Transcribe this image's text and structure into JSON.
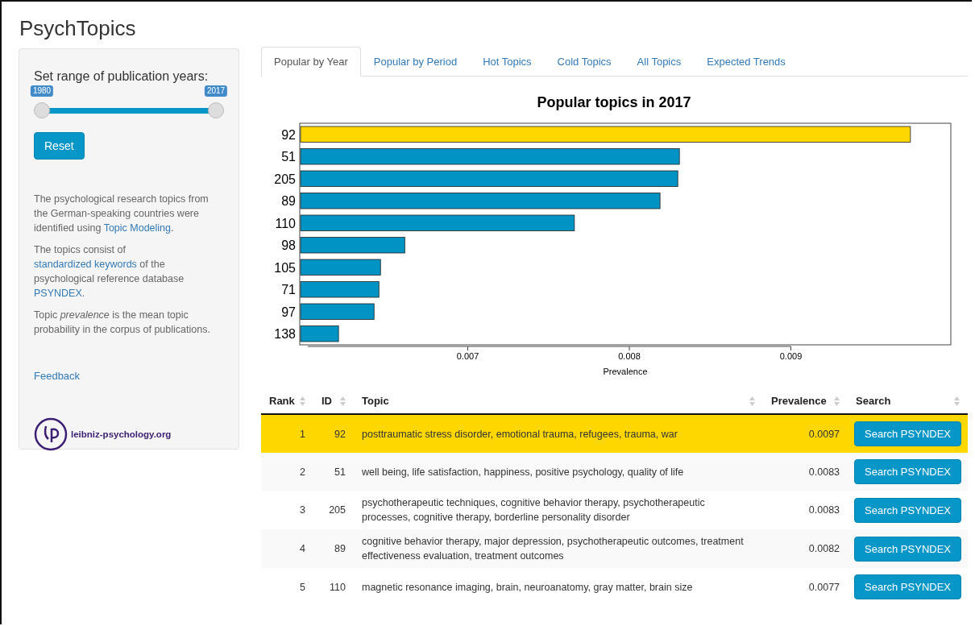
{
  "app_title": "PsychTopics",
  "sidebar": {
    "slider_label": "Set range of publication years:",
    "slider_handles": [
      {
        "label": "1980"
      },
      {
        "label": "2017"
      }
    ],
    "reset_button": "Reset",
    "paragraphs": [
      [
        {
          "kind": "plain",
          "text": "The psychological research topics from the German-speaking countries were identified using "
        },
        {
          "kind": "link",
          "text": "Topic Modeling"
        },
        {
          "kind": "plain",
          "text": "."
        }
      ],
      [
        {
          "kind": "plain",
          "text": "The topics consist of "
        },
        {
          "kind": "link",
          "text": "standardized keywords"
        },
        {
          "kind": "plain",
          "text": " of the psychological reference database "
        },
        {
          "kind": "link",
          "text": "PSYNDEX"
        },
        {
          "kind": "plain",
          "text": "."
        }
      ],
      [
        {
          "kind": "plain",
          "text": "Topic "
        },
        {
          "kind": "italic",
          "text": "prevalence"
        },
        {
          "kind": "plain",
          "text": " is the mean topic probability in the corpus of publications."
        }
      ]
    ],
    "feedback_link": "Feedback",
    "logo_text": "leibniz-psychology.org"
  },
  "tabs": [
    {
      "label": "Popular by Year",
      "selected": true
    },
    {
      "label": "Popular by Period",
      "selected": false
    },
    {
      "label": "Hot Topics",
      "selected": false
    },
    {
      "label": "Cold Topics",
      "selected": false
    },
    {
      "label": "All Topics",
      "selected": false
    },
    {
      "label": "Expected Trends",
      "selected": false
    }
  ],
  "chart_data": {
    "type": "bar",
    "orientation": "horizontal",
    "title": "Popular topics in 2017",
    "xlabel": "Prevalence",
    "categories": [
      "92",
      "51",
      "205",
      "89",
      "110",
      "98",
      "105",
      "71",
      "97",
      "138"
    ],
    "series": [
      {
        "color": "#ffd700",
        "values": [
          0.00974,
          null,
          null,
          null,
          null,
          null,
          null,
          null,
          null,
          null
        ]
      },
      {
        "color": "#0093c4",
        "values": [
          null,
          0.00831,
          0.0083,
          0.00819,
          0.00766,
          0.00661,
          0.00646,
          0.00645,
          0.00642,
          0.0062
        ]
      }
    ],
    "xlim": [
      0.00596,
      0.00999
    ],
    "xticks": [
      0.007,
      0.008,
      0.009
    ]
  },
  "table": {
    "columns": [
      "Rank",
      "ID",
      "Topic",
      "Prevalence",
      "Search"
    ],
    "rows": [
      {
        "rank": "1",
        "id": "92",
        "topic": "posttraumatic stress disorder, emotional trauma, refugees, trauma, war",
        "prevalence": "0.0097",
        "button": "Search PSYNDEX",
        "selected": true
      },
      {
        "rank": "2",
        "id": "51",
        "topic": "well being, life satisfaction, happiness, positive psychology, quality of life",
        "prevalence": "0.0083",
        "button": "Search PSYNDEX",
        "selected": false
      },
      {
        "rank": "3",
        "id": "205",
        "topic": "psychotherapeutic techniques, cognitive behavior therapy, psychotherapeutic processes, cognitive therapy, borderline personality disorder",
        "prevalence": "0.0083",
        "button": "Search PSYNDEX",
        "selected": false
      },
      {
        "rank": "4",
        "id": "89",
        "topic": "cognitive behavior therapy, major depression, psychotherapeutic outcomes, treatment effectiveness evaluation, treatment outcomes",
        "prevalence": "0.0082",
        "button": "Search PSYNDEX",
        "selected": false
      },
      {
        "rank": "5",
        "id": "110",
        "topic": "magnetic resonance imaging, brain, neuroanatomy, gray matter, brain size",
        "prevalence": "0.0077",
        "button": "Search PSYNDEX",
        "selected": false
      }
    ]
  }
}
